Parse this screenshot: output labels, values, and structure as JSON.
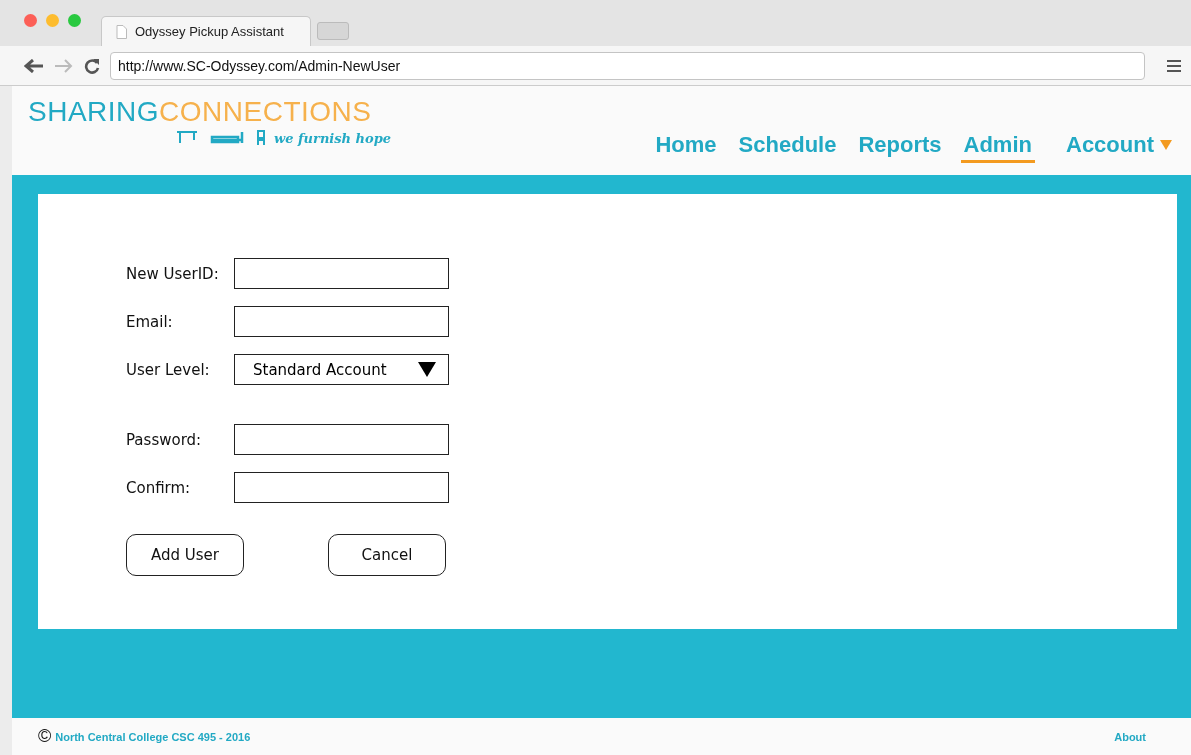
{
  "browser": {
    "tabs": [
      {
        "title": "Odyssey Pickup Assistant",
        "selected": true
      },
      {
        "kind": "new",
        "selected": false
      }
    ],
    "url": "http://www.SC-Odyssey.com/Admin-NewUser"
  },
  "logo": {
    "first": "SHARING",
    "second": "CONNECTIONS",
    "tagline": "we furnish hope"
  },
  "nav": [
    {
      "label": "Home",
      "selected": false,
      "dropdown": false
    },
    {
      "label": "Schedule",
      "selected": false,
      "dropdown": false
    },
    {
      "label": "Reports",
      "selected": false,
      "dropdown": false
    },
    {
      "label": "Admin",
      "selected": true,
      "dropdown": false
    },
    {
      "label": "Account",
      "selected": false,
      "dropdown": true
    }
  ],
  "form": {
    "groups": [
      {
        "fields": [
          {
            "label": "New UserID:",
            "kind": "text"
          },
          {
            "label": "Email:",
            "kind": "text"
          },
          {
            "label": "User Level:",
            "kind": "select",
            "value": "Standard Account"
          }
        ]
      },
      {
        "fields": [
          {
            "label": "Password:",
            "kind": "text"
          },
          {
            "label": "Confirm:",
            "kind": "text"
          }
        ]
      }
    ],
    "buttons": [
      "Add User",
      "Cancel"
    ]
  },
  "footer": {
    "copyright_symbol": "©",
    "text": "North Central College CSC 495 - 2016",
    "link": "About"
  }
}
